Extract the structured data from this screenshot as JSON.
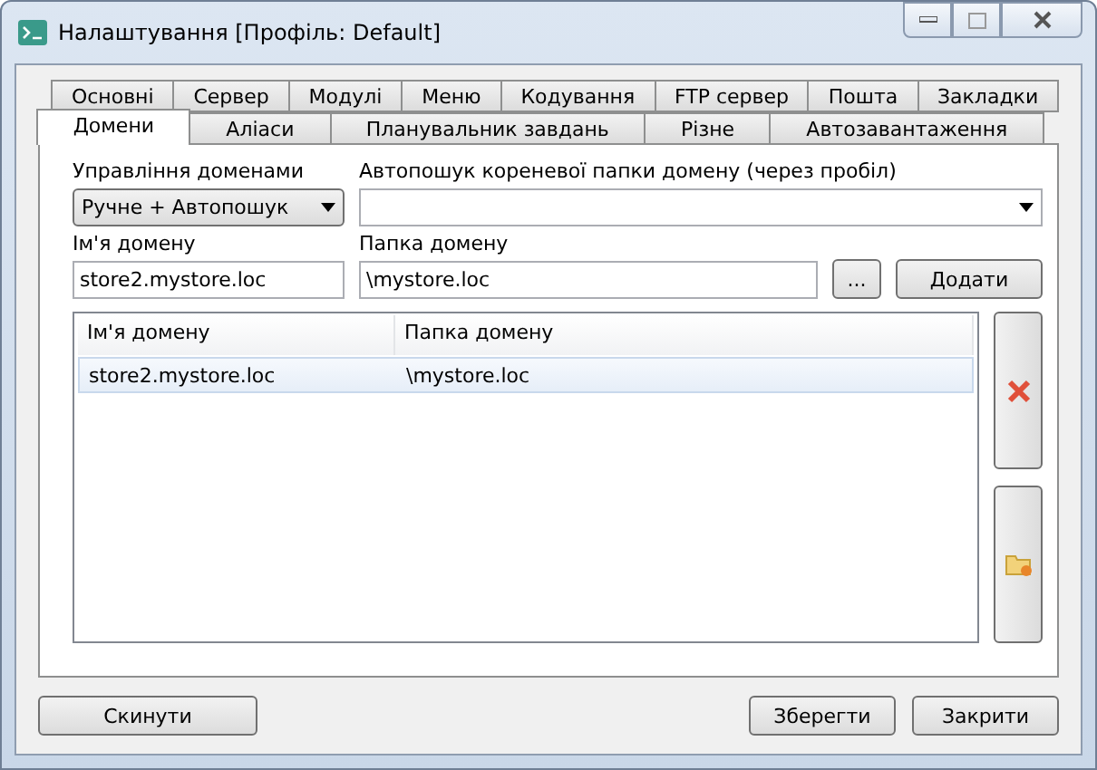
{
  "window": {
    "title": "Налаштування [Профіль: Default]"
  },
  "tab_rows": [
    [
      {
        "label": "Основні",
        "selected": false
      },
      {
        "label": "Сервер",
        "selected": false
      },
      {
        "label": "Модулі",
        "selected": false
      },
      {
        "label": "Меню",
        "selected": false
      },
      {
        "label": "Кодування",
        "selected": false
      },
      {
        "label": "FTP сервер",
        "selected": false
      },
      {
        "label": "Пошта",
        "selected": false
      },
      {
        "label": "Закладки",
        "selected": false
      }
    ],
    [
      {
        "label": "Домени",
        "selected": true
      },
      {
        "label": "Аліаси",
        "selected": false
      },
      {
        "label": "Планувальник завдань",
        "selected": false
      },
      {
        "label": "Різне",
        "selected": false
      },
      {
        "label": "Автозавантаження",
        "selected": false
      }
    ]
  ],
  "domain_management": {
    "label": "Управління доменами",
    "value": "Ручне + Автопошук"
  },
  "autosearch": {
    "label": "Автопошук кореневої папки домену (через пробіл)"
  },
  "domain_name": {
    "label": "Ім'я домену",
    "value": "store2.mystore.loc"
  },
  "domain_folder": {
    "label": "Папка домену",
    "value": "\\mystore.loc"
  },
  "browse_button": "...",
  "add_button": "Додати",
  "table": {
    "columns": [
      "Ім'я домену",
      "Папка домену"
    ],
    "rows": [
      {
        "cells": [
          "store2.mystore.loc",
          "\\mystore.loc"
        ],
        "selected": true
      }
    ]
  },
  "buttons": {
    "reset": "Скинути",
    "save": "Зберегти",
    "close": "Закрити"
  }
}
